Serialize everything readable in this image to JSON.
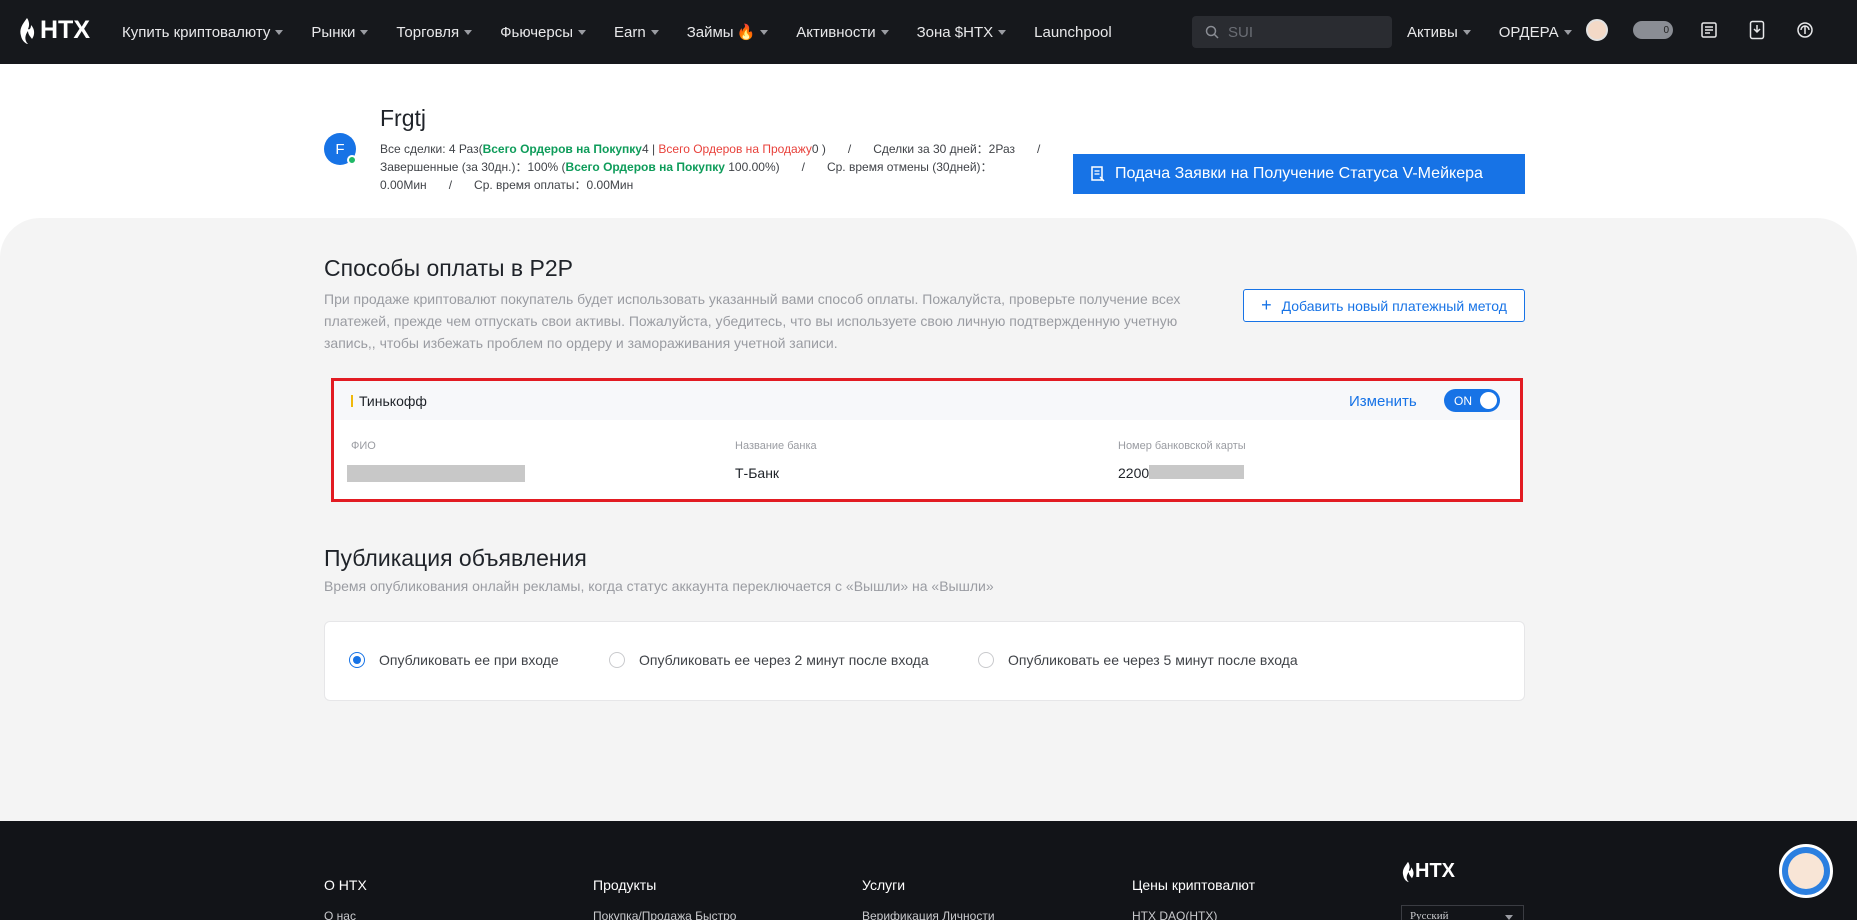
{
  "nav": {
    "logo_text": "HTX",
    "links": [
      {
        "label": "Купить криптовалюту",
        "dropdown": true
      },
      {
        "label": "Рынки",
        "dropdown": true
      },
      {
        "label": "Торговля",
        "dropdown": true
      },
      {
        "label": "Фьючерсы",
        "dropdown": true
      },
      {
        "label": "Earn",
        "dropdown": true
      },
      {
        "label": "Займы",
        "dropdown": true,
        "badge": "fire-icon"
      },
      {
        "label": "Активности",
        "dropdown": true
      },
      {
        "label": "Зона $HTX",
        "dropdown": true
      },
      {
        "label": "Launchpool",
        "dropdown": false
      }
    ],
    "search_placeholder": "SUI",
    "assets_label": "Активы",
    "orders_label": "ОРДЕРА",
    "toggle_label": "0"
  },
  "profile": {
    "avatar_letter": "F",
    "name": "Frgtj",
    "stats": {
      "all_trades_prefix": "Все сделки: 4 Раз(",
      "buy_orders_label": "Всего Ордеров на Покупку",
      "buy_orders_value": "4",
      "pipe": " | ",
      "sell_orders_label": "Всего Ордеров на Продажу",
      "sell_orders_value": "0 )",
      "trades_30d": "Сделки за 30 дней：2Раз",
      "completed_30d_prefix": "Завершенные (за 30дн.)：100%  (",
      "completed_buy_label": "Всего Ордеров на Покупку",
      "completed_buy_value": " 100.00%)",
      "avg_cancel_time": "Ср. время отмены (30дней)：0.00Мин",
      "avg_pay_time": "Ср. время оплаты：0.00Мин",
      "separator": "/"
    },
    "vmaker_button": "Подача Заявки на Получение Статуса V-Мейкера"
  },
  "payment_methods": {
    "title": "Способы оплаты в P2P",
    "description": "При продаже криптовалют покупатель будет использовать указанный вами способ оплаты. Пожалуйста, проверьте получение всех платежей, прежде чем отпускать свои активы. Пожалуйста, убедитесь, что вы используете свою личную подтвержденную учетную запись,, чтобы избежать проблем по ордеру и замораживания учетной записи.",
    "add_button": "Добавить новый платежный метод",
    "card": {
      "name": "Тинькофф",
      "edit_label": "Изменить",
      "switch_label": "ON",
      "switch_on": true,
      "fields": [
        {
          "label": "ФИО",
          "value": ""
        },
        {
          "label": "Название банка",
          "value": "Т-Банк"
        },
        {
          "label": "Номер банковской карты",
          "value": "2200"
        }
      ]
    }
  },
  "publication": {
    "title": "Публикация объявления",
    "description": "Время опубликования онлайн рекламы, когда статус аккаунта переключается с «Вышли» на «Вышли»",
    "options": [
      {
        "label": "Опубликовать ее при входе",
        "checked": true
      },
      {
        "label": "Опубликовать ее через 2 минут после входа",
        "checked": false
      },
      {
        "label": "Опубликовать ее через 5 минут после входа",
        "checked": false
      }
    ]
  },
  "footer": {
    "columns": [
      {
        "heading": "О HTX",
        "first_link": "О нас"
      },
      {
        "heading": "Продукты",
        "first_link": "Покупка/Продажа Быстро"
      },
      {
        "heading": "Услуги",
        "first_link": "Верификация Личности"
      },
      {
        "heading": "Цены криптовалют",
        "first_link": "HTX DAO(HTX)"
      }
    ],
    "logo_text": "HTX",
    "language": "Русский"
  },
  "colors": {
    "accent": "#1773e6",
    "nav_bg": "#16181c",
    "buy_green": "#0e9c5a",
    "sell_red": "#e8413b",
    "highlight_border": "#e21b22"
  }
}
